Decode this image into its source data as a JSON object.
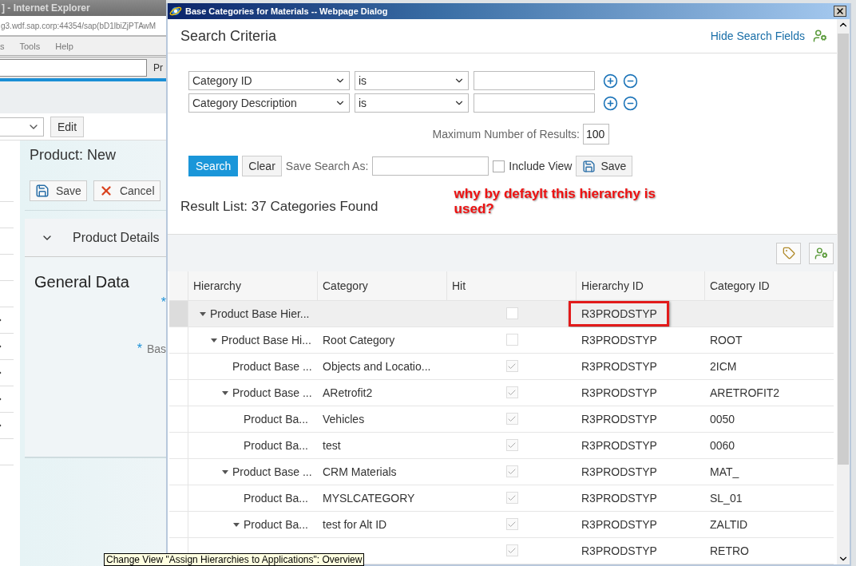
{
  "background_window": {
    "title": "] - Internet Explorer",
    "address": "g3.wdf.sap.corp:44354/sap(bD1lbiZjPTAwM",
    "menu": [
      "s",
      "Tools",
      "Help"
    ],
    "toolbar_label": "Pr",
    "edit_button": "Edit",
    "page_title": "Product: New",
    "buttons": [
      {
        "kind": "save",
        "label": "Save"
      },
      {
        "kind": "cancel",
        "label": "Cancel"
      }
    ],
    "section": {
      "title": "Product Details",
      "expanded": true
    },
    "group_title": "General Data",
    "fields": [
      {
        "required_mark": "*"
      },
      {
        "required_mark": "*",
        "label": "Bas"
      }
    ],
    "side_rows": [
      {
        "has_arrow": false
      },
      {
        "has_arrow": false
      },
      {
        "has_arrow": false
      },
      {
        "has_arrow": false
      },
      {
        "has_arrow": false
      },
      {
        "has_arrow": true
      },
      {
        "has_arrow": true
      },
      {
        "has_arrow": true
      },
      {
        "has_arrow": true
      },
      {
        "has_arrow": true
      },
      {
        "has_arrow": false
      }
    ]
  },
  "dialog": {
    "title": "Base Categories for Materials -- Webpage Dialog",
    "search": {
      "title": "Search Criteria",
      "toggle_link": "Hide Search Fields",
      "criteria": [
        {
          "field": "Category ID",
          "operator": "is"
        },
        {
          "field": "Category Description",
          "operator": "is"
        }
      ],
      "max_results_label": "Maximum Number of Results:",
      "max_results": "100",
      "search_button": "Search",
      "clear_button": "Clear",
      "save_as_label": "Save Search As:",
      "include_view": {
        "label": "Include View",
        "checked": false
      },
      "save_button": "Save"
    },
    "results": {
      "title": "Result List: 37 Categories Found",
      "columns": [
        "Hierarchy",
        "Category",
        "Hit",
        "Hierarchy ID",
        "Category ID"
      ],
      "rows": [
        {
          "hierarchy": "Product Base Hier...",
          "hit": false,
          "hierarchy_id": "R3PRODSTYP",
          "expanded": true,
          "selected": true,
          "highlighted": true,
          "children": [
            {
              "hierarchy": "Product Base Hi...",
              "category": "Root Category",
              "hit": false,
              "hierarchy_id": "R3PRODSTYP",
              "category_id": "ROOT",
              "expanded": true,
              "selected": false,
              "highlighted": false,
              "children": [
                {
                  "hierarchy": "Product Base ...",
                  "category": "Objects and Locatio...",
                  "hit": true,
                  "hierarchy_id": "R3PRODSTYP",
                  "category_id": "2ICM",
                  "selected": false,
                  "highlighted": false
                },
                {
                  "hierarchy": "Product Base ...",
                  "category": "ARetrofit2",
                  "hit": true,
                  "hierarchy_id": "R3PRODSTYP",
                  "category_id": "ARETROFIT2",
                  "expanded": true,
                  "selected": false,
                  "highlighted": false,
                  "children": [
                    {
                      "hierarchy": "Product Ba...",
                      "category": "Vehicles",
                      "hit": true,
                      "hierarchy_id": "R3PRODSTYP",
                      "category_id": "0050",
                      "selected": false,
                      "highlighted": false
                    },
                    {
                      "hierarchy": "Product Ba...",
                      "category": "test",
                      "hit": true,
                      "hierarchy_id": "R3PRODSTYP",
                      "category_id": "0060",
                      "selected": false,
                      "highlighted": false
                    }
                  ]
                },
                {
                  "hierarchy": "Product Base ...",
                  "category": "CRM Materials",
                  "hit": true,
                  "hierarchy_id": "R3PRODSTYP",
                  "category_id": "MAT_",
                  "expanded": true,
                  "selected": false,
                  "highlighted": false,
                  "children": [
                    {
                      "hierarchy": "Product Ba...",
                      "category": "MYSLCATEGORY",
                      "hit": true,
                      "hierarchy_id": "R3PRODSTYP",
                      "category_id": "SL_01",
                      "selected": false,
                      "highlighted": false
                    },
                    {
                      "hierarchy": "Product Ba...",
                      "category": "test for Alt ID",
                      "hit": true,
                      "hierarchy_id": "R3PRODSTYP",
                      "category_id": "ZALTID",
                      "expanded": true,
                      "selected": false,
                      "highlighted": false,
                      "children": [
                        {
                          "hit": true,
                          "hierarchy_id": "R3PRODSTYP",
                          "category_id": "RETRO",
                          "selected": false,
                          "highlighted": false
                        }
                      ]
                    }
                  ]
                }
              ]
            }
          ]
        }
      ]
    }
  },
  "annotation": "why by defaylt this hierarchy is used?",
  "tooltip": "Change View \"Assign Hierarchies to Applications\": Overview"
}
